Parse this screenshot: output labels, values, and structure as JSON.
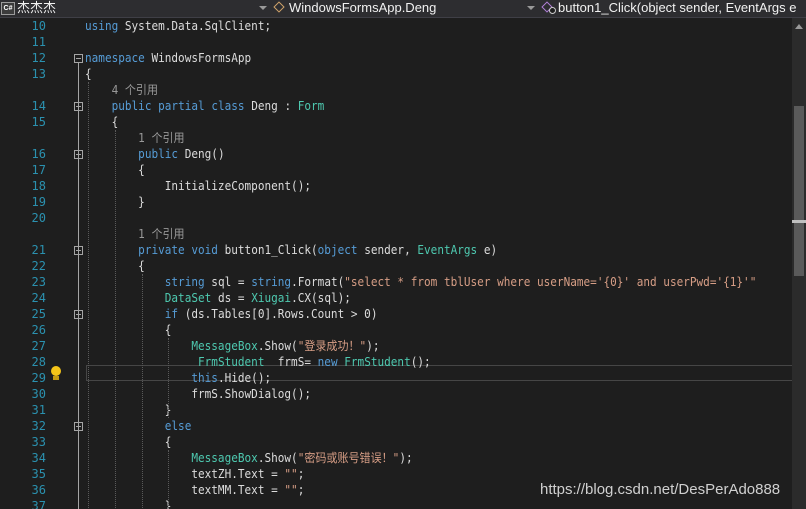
{
  "navbar": {
    "project_icon": "csharp-project-icon",
    "project": "杰杰杰",
    "class_path": "WindowsFormsApp.Deng",
    "method_signature": "button1_Click(object sender, EventArgs e"
  },
  "editor": {
    "current_line": 29,
    "lightbulb_line": 29,
    "lines": [
      {
        "n": "10",
        "text": "using System.Data.SqlClient;"
      },
      {
        "n": "11",
        "text": ""
      },
      {
        "n": "12",
        "text": "namespace WindowsFormsApp"
      },
      {
        "n": "13",
        "text": "{"
      },
      {
        "lens": "4 个引用"
      },
      {
        "n": "14",
        "text": "public partial class Deng : Form"
      },
      {
        "n": "15",
        "text": "{"
      },
      {
        "lens": "1 个引用"
      },
      {
        "n": "16",
        "text": "public Deng()"
      },
      {
        "n": "17",
        "text": "{"
      },
      {
        "n": "18",
        "text": "InitializeComponent();"
      },
      {
        "n": "19",
        "text": "}"
      },
      {
        "n": "20",
        "text": ""
      },
      {
        "lens": "1 个引用"
      },
      {
        "n": "21",
        "text": "private void button1_Click(object sender, EventArgs e)"
      },
      {
        "n": "22",
        "text": "{"
      },
      {
        "n": "23",
        "text": "string sql = string.Format(\"select * from tblUser where userName='{0}' and userPwd='{1}'\""
      },
      {
        "n": "24",
        "text": "DataSet ds = Xiugai.CX(sql);"
      },
      {
        "n": "25",
        "text": "if (ds.Tables[0].Rows.Count > 0)"
      },
      {
        "n": "26",
        "text": "{"
      },
      {
        "n": "27",
        "text": "MessageBox.Show(\"登录成功！\");"
      },
      {
        "n": "28",
        "text": " FrmStudent  frmS= new FrmStudent();"
      },
      {
        "n": "29",
        "text": "this.Hide();"
      },
      {
        "n": "30",
        "text": "frmS.ShowDialog();"
      },
      {
        "n": "31",
        "text": "}"
      },
      {
        "n": "32",
        "text": "else"
      },
      {
        "n": "33",
        "text": "{"
      },
      {
        "n": "34",
        "text": "MessageBox.Show(\"密码或账号错误！\");"
      },
      {
        "n": "35",
        "text": "textZH.Text = \"\";"
      },
      {
        "n": "36",
        "text": "textMM.Text = \"\";"
      },
      {
        "n": "37",
        "text": "}"
      }
    ]
  },
  "watermark": "https://blog.csdn.net/DesPerAdo888",
  "colors": {
    "background": "#1e1e1e",
    "keyword": "#569cd6",
    "type": "#4ec9b0",
    "string": "#d69d85",
    "line_number": "#2b91af",
    "code_lens": "#999999"
  }
}
